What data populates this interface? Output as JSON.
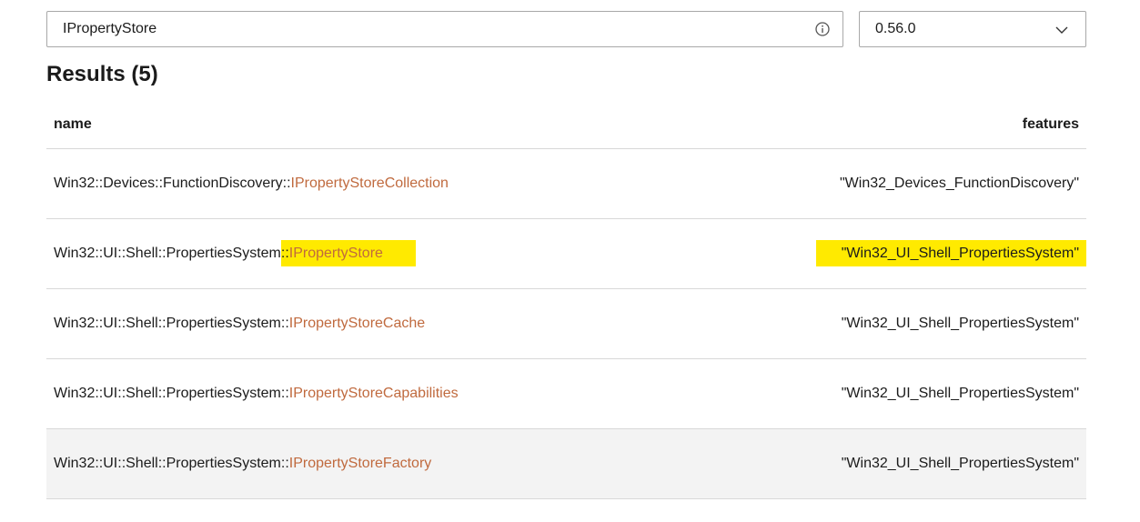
{
  "search": {
    "value": "IPropertyStore"
  },
  "version_select": {
    "selected": "0.56.0"
  },
  "results": {
    "heading": "Results (5)",
    "columns": {
      "name": "name",
      "features": "features"
    },
    "rows": [
      {
        "namespace": "Win32::Devices::FunctionDiscovery",
        "separator": "::",
        "item": "IPropertyStoreCollection",
        "features": "\"Win32_Devices_FunctionDiscovery\""
      },
      {
        "namespace": "Win32::UI::Shell::PropertiesSystem",
        "separator": "::",
        "item": "IPropertyStore",
        "features": "\"Win32_UI_Shell_PropertiesSystem\""
      },
      {
        "namespace": "Win32::UI::Shell::PropertiesSystem",
        "separator": "::",
        "item": "IPropertyStoreCache",
        "features": "\"Win32_UI_Shell_PropertiesSystem\""
      },
      {
        "namespace": "Win32::UI::Shell::PropertiesSystem",
        "separator": "::",
        "item": "IPropertyStoreCapabilities",
        "features": "\"Win32_UI_Shell_PropertiesSystem\""
      },
      {
        "namespace": "Win32::UI::Shell::PropertiesSystem",
        "separator": "::",
        "item": "IPropertyStoreFactory",
        "features": "\"Win32_UI_Shell_PropertiesSystem\""
      }
    ]
  },
  "icons": {
    "info": "info-icon",
    "dropdown": "chevron-down-icon"
  },
  "colors": {
    "item_link": "#c06a3e",
    "highlight": "#ffea00",
    "row_hover": "#f3f3f3",
    "divider": "#d8d8d8"
  }
}
